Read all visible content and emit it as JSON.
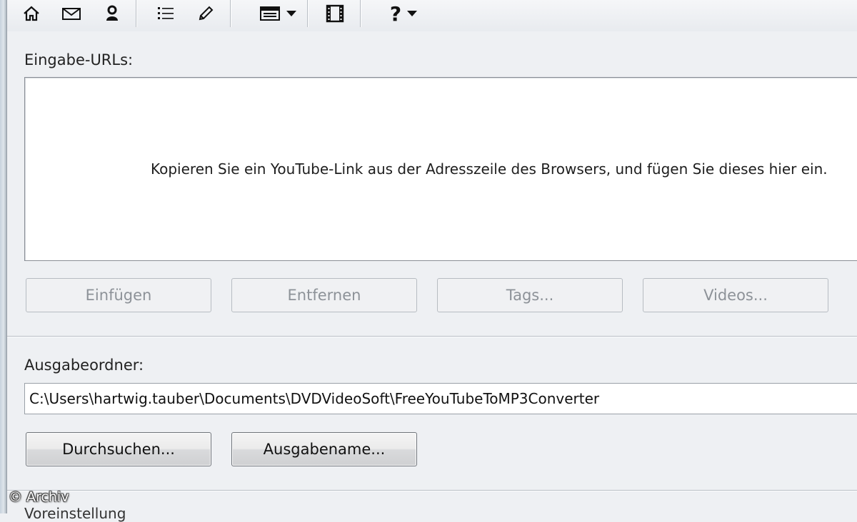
{
  "toolbar": {
    "icons": [
      "home-icon",
      "mail-icon",
      "user-icon",
      "list-icon",
      "pencil-icon",
      "window-icon",
      "film-icon",
      "help-icon"
    ],
    "help_label": "?"
  },
  "input_urls": {
    "label": "Eingabe-URLs:",
    "hint": "Kopieren Sie ein YouTube-Link aus der Adresszeile des Browsers, und fügen Sie dieses hier ein."
  },
  "url_buttons": {
    "paste": "Einfügen",
    "remove": "Entfernen",
    "tags": "Tags...",
    "videos": "Videos..."
  },
  "output": {
    "label": "Ausgabeordner:",
    "path": "C:\\Users\\hartwig.tauber\\Documents\\DVDVideoSoft\\FreeYouTubeToMP3Converter",
    "browse_label": "Durchsuchen...",
    "output_name_label": "Ausgabename..."
  },
  "watermark": "© Archiv",
  "next_section_label": "Voreinstellung"
}
